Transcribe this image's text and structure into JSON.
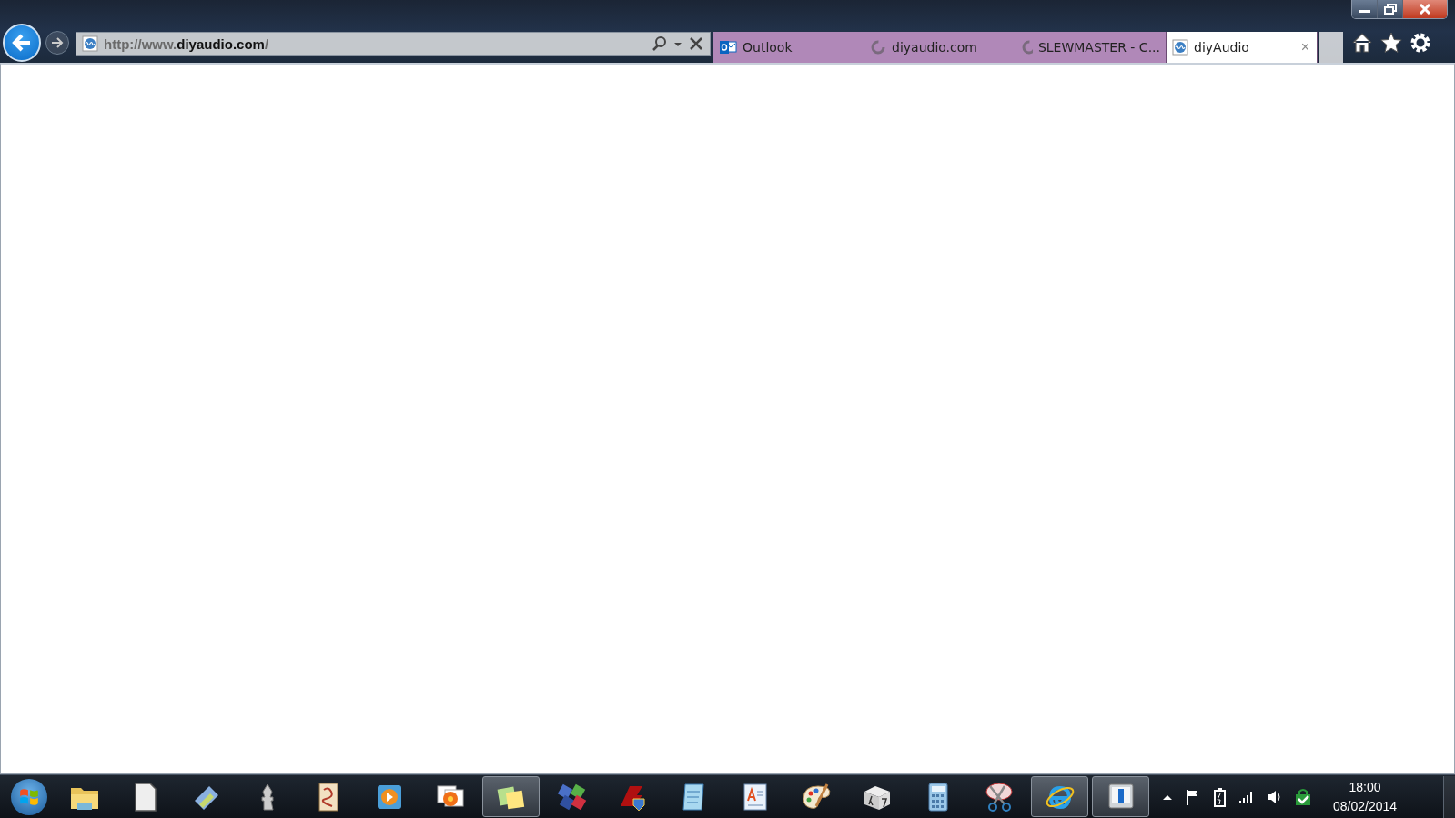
{
  "address_bar": {
    "url_prefix": "http://www.",
    "url_domain": "diyaudio.com",
    "url_suffix": "/"
  },
  "tabs": [
    {
      "label": "Outlook",
      "kind": "mail",
      "selected": false
    },
    {
      "label": "diyaudio.com",
      "kind": "loading",
      "selected": false
    },
    {
      "label": "SLEWMASTER - C...",
      "kind": "loading",
      "selected": false
    },
    {
      "label": "diyAudio",
      "kind": "site",
      "selected": true
    }
  ],
  "close_tab_glyph": "×",
  "taskbar": {
    "items": [
      {
        "kind": "folder",
        "active": false
      },
      {
        "kind": "document",
        "active": false
      },
      {
        "kind": "scanner",
        "active": false
      },
      {
        "kind": "chess",
        "active": false
      },
      {
        "kind": "tile",
        "active": false
      },
      {
        "kind": "media",
        "active": false
      },
      {
        "kind": "photos",
        "active": false
      },
      {
        "kind": "notes",
        "active": true
      },
      {
        "kind": "games",
        "active": false
      },
      {
        "kind": "shield",
        "active": false
      },
      {
        "kind": "notepad",
        "active": false
      },
      {
        "kind": "wordpad",
        "active": false
      },
      {
        "kind": "paint",
        "active": false
      },
      {
        "kind": "math",
        "active": false
      },
      {
        "kind": "calculator",
        "active": false
      },
      {
        "kind": "scissors",
        "active": false
      },
      {
        "kind": "browser",
        "active": true
      },
      {
        "kind": "monitor",
        "active": true
      }
    ],
    "clock": {
      "time": "18:00",
      "date": "08/02/2014"
    }
  }
}
